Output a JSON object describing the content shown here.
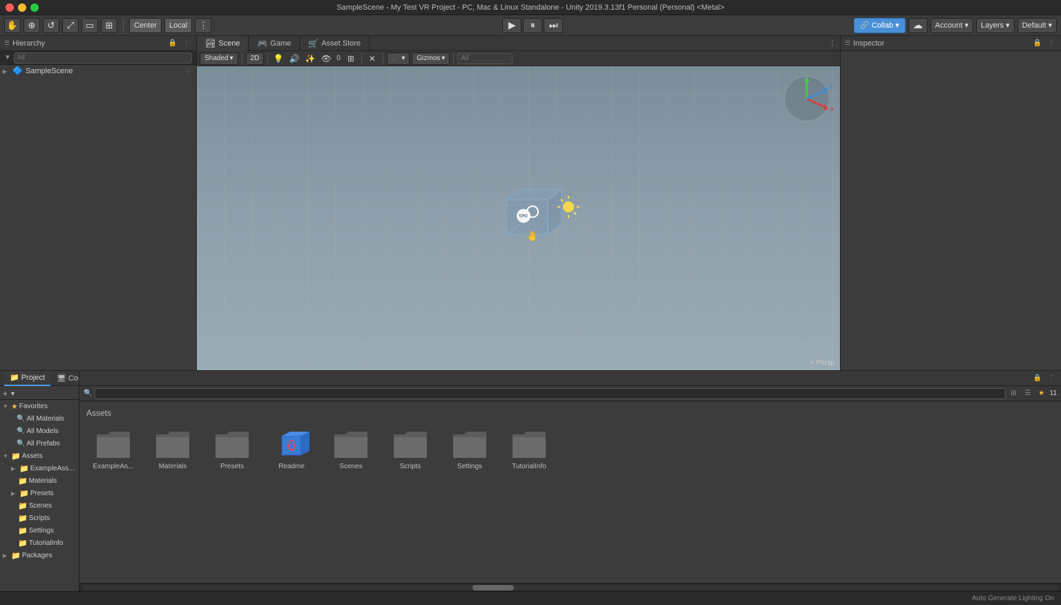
{
  "titleBar": {
    "title": "SampleScene - My Test VR Project - PC, Mac & Linux Standalone - Unity 2019.3.13f1 Personal (Personal) <Metal>"
  },
  "toolbar": {
    "handLabel": "✋",
    "moveLabel": "⊕",
    "rotateLabel": "↺",
    "scaleLabel": "⤢",
    "rectLabel": "▭",
    "transformLabel": "⊞",
    "centerLabel": "Center",
    "localLabel": "Local",
    "pivotLabel": "⋮",
    "playLabel": "▶",
    "pauseLabel": "⏸",
    "stepLabel": "⏭",
    "collabLabel": "Collab ▾",
    "cloudLabel": "☁",
    "accountLabel": "Account ▾",
    "layersLabel": "Layers ▾",
    "defaultLabel": "Default ▾"
  },
  "hierarchy": {
    "title": "Hierarchy",
    "searchPlaceholder": "All",
    "items": [
      {
        "label": "SampleScene",
        "icon": "🔷",
        "level": 0,
        "arrow": "▶"
      }
    ]
  },
  "sceneTabs": [
    {
      "label": "Scene",
      "icon": "🏞",
      "active": true
    },
    {
      "label": "Game",
      "icon": "🎮",
      "active": false
    },
    {
      "label": "Asset Store",
      "icon": "🛒",
      "active": false
    }
  ],
  "sceneToolbar": {
    "shading": "Shaded",
    "twod": "2D",
    "gizmos": "Gizmos",
    "searchPlaceholder": "All"
  },
  "gizmo": {
    "perspLabel": "< Persp",
    "xLabel": "x",
    "yLabel": "y",
    "zLabel": "z"
  },
  "inspector": {
    "title": "Inspector"
  },
  "bottomTabs": [
    {
      "label": "Project",
      "icon": "📁",
      "active": true
    },
    {
      "label": "Console",
      "icon": "🖥",
      "active": false
    }
  ],
  "projectPanel": {
    "searchPlaceholder": "",
    "assetsTitle": "Assets",
    "treeItems": [
      {
        "label": "Favorites",
        "level": 0,
        "arrow": "▼",
        "isFolder": false,
        "isFav": true
      },
      {
        "label": "All Materials",
        "level": 1,
        "icon": "🔍"
      },
      {
        "label": "All Models",
        "level": 1,
        "icon": "🔍"
      },
      {
        "label": "All Prefabs",
        "level": 1,
        "icon": "🔍"
      },
      {
        "label": "Assets",
        "level": 0,
        "arrow": "▼",
        "isFolder": true
      },
      {
        "label": "ExampleAss...",
        "level": 1,
        "arrow": "▶",
        "isFolder": true
      },
      {
        "label": "Materials",
        "level": 1,
        "isFolder": true
      },
      {
        "label": "Presets",
        "level": 1,
        "arrow": "▶",
        "isFolder": true
      },
      {
        "label": "Scenes",
        "level": 1,
        "isFolder": true
      },
      {
        "label": "Scripts",
        "level": 1,
        "isFolder": true
      },
      {
        "label": "Settings",
        "level": 1,
        "isFolder": true
      },
      {
        "label": "TutorialInfo",
        "level": 1,
        "isFolder": true
      },
      {
        "label": "Packages",
        "level": 0,
        "arrow": "▶",
        "isFolder": true
      }
    ],
    "assetItems": [
      {
        "label": "ExampleAs...",
        "type": "folder"
      },
      {
        "label": "Materials",
        "type": "folder"
      },
      {
        "label": "Presets",
        "type": "folder"
      },
      {
        "label": "Readme",
        "type": "readme"
      },
      {
        "label": "Scenes",
        "type": "folder"
      },
      {
        "label": "Scripts",
        "type": "folder"
      },
      {
        "label": "Settings",
        "type": "folder"
      },
      {
        "label": "TutorialInfo",
        "type": "folder"
      }
    ]
  },
  "statusBar": {
    "text": "Auto Generate Lighting On"
  },
  "colors": {
    "folderColor": "#6b6b6b",
    "readmeColor": "#3a7bd5",
    "tabActive": "#3c3c3c",
    "tabInactive": "#383838"
  }
}
